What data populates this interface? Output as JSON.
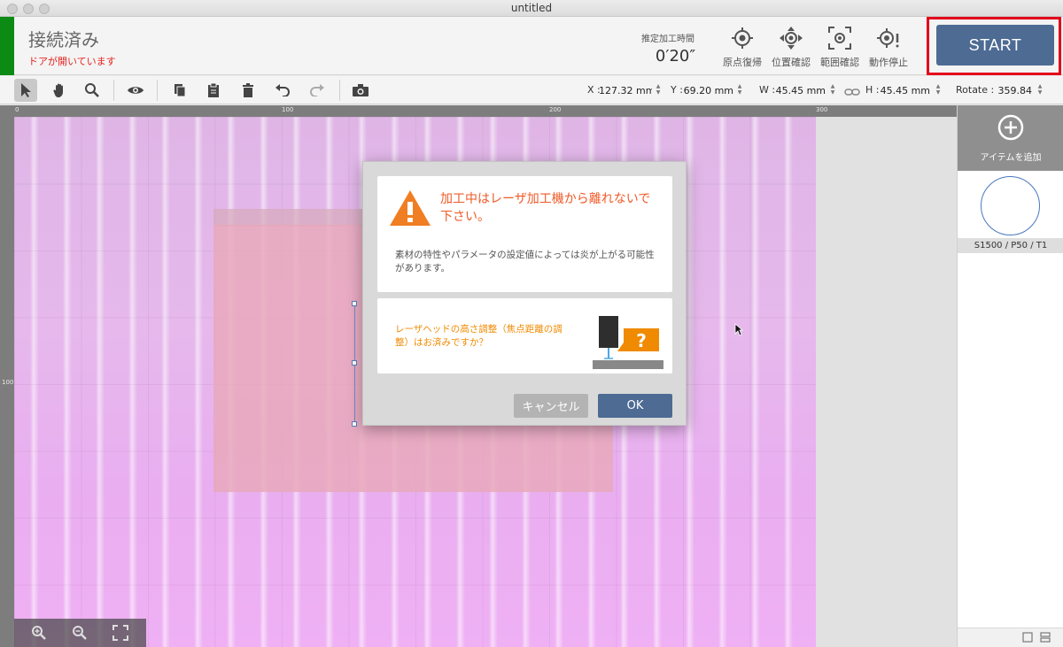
{
  "window": {
    "title": "untitled"
  },
  "status": {
    "connection": "接続済み",
    "door_warning": "ドアが開いています",
    "estimated_time_label": "推定加工時間",
    "estimated_time_value": "0′20″"
  },
  "header_buttons": [
    {
      "label": "原点復帰",
      "icon": "origin-return-icon"
    },
    {
      "label": "位置確認",
      "icon": "position-check-icon"
    },
    {
      "label": "範囲確認",
      "icon": "range-check-icon"
    },
    {
      "label": "動作停止",
      "icon": "stop-operation-icon"
    }
  ],
  "start_button": {
    "label": "START",
    "color": "#4d6b93",
    "highlight_color": "#e3001b"
  },
  "toolbar": {
    "tools": [
      "select-arrow-icon",
      "hand-pan-icon",
      "zoom-icon",
      "eye-icon",
      "copy-icon",
      "paste-icon",
      "trash-icon",
      "undo-icon",
      "redo-icon",
      "camera-icon"
    ],
    "x_label": "X :",
    "x_value": "127.32 mm",
    "y_label": "Y :",
    "y_value": "69.20 mm",
    "w_label": "W :",
    "w_value": "45.45 mm",
    "h_label": "H :",
    "h_value": "45.45 mm",
    "rotate_label": "Rotate :",
    "rotate_value": "359.84"
  },
  "ruler": {
    "top_labels": [
      "0",
      "100",
      "200",
      "300"
    ],
    "left_labels": [
      "100"
    ]
  },
  "side_panel": {
    "add_item_label": "アイテムを追加",
    "item_label": "S1500 / P50 / T1"
  },
  "dialog": {
    "warning_title": "加工中はレーザ加工機から離れないで下さい。",
    "warning_body": "素材の特性やパラメータの設定値によっては炎が上がる可能性があります。",
    "question": "レーザヘッドの高さ調整（焦点距離の調整）はお済みですか？",
    "cancel_label": "キャンセル",
    "ok_label": "OK",
    "accent_color": "#ef5a27"
  }
}
